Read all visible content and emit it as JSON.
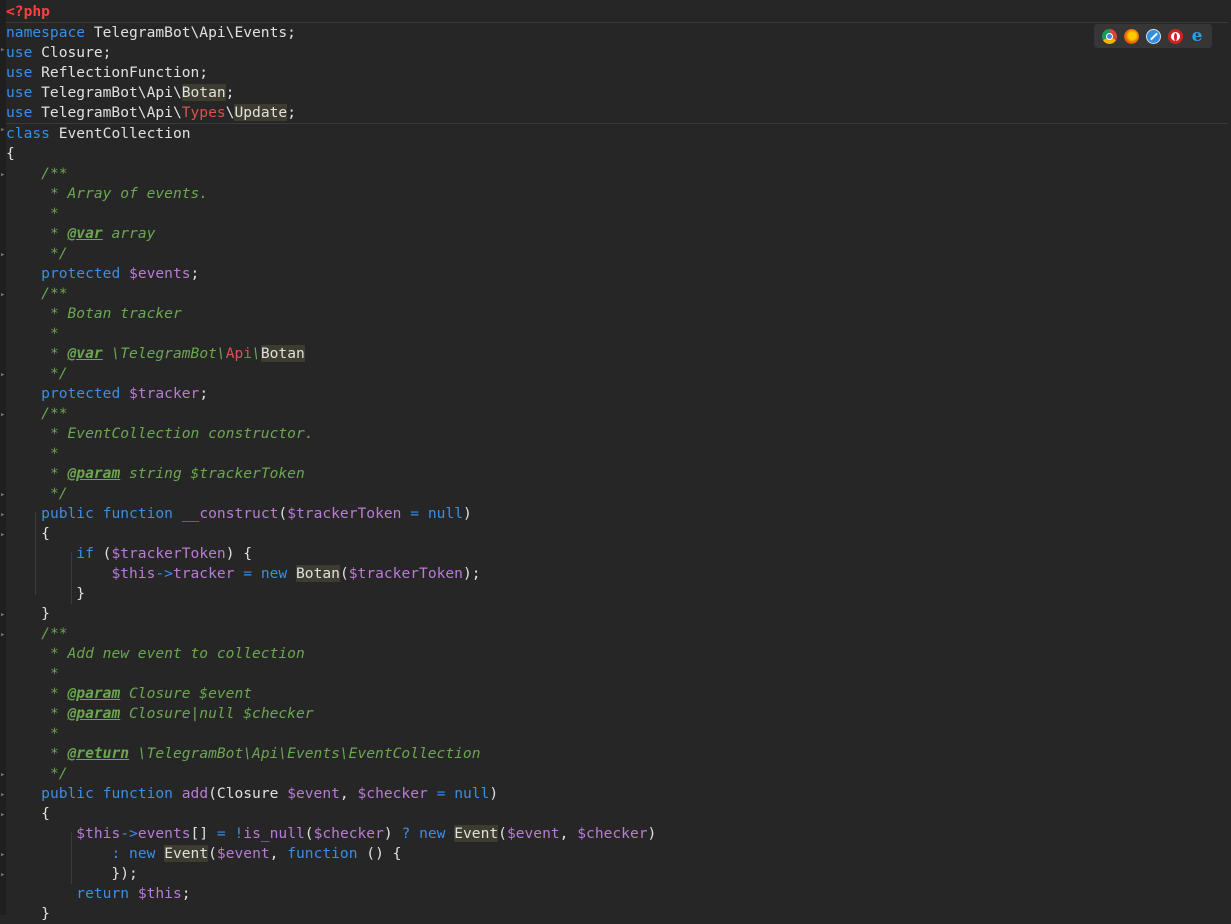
{
  "editor": {
    "language": "php",
    "lines": [
      [
        {
          "t": "<?php",
          "c": "tag"
        }
      ],
      [
        {
          "t": "namespace",
          "c": "kw"
        },
        {
          "t": " TelegramBot\\Api\\Events;"
        }
      ],
      [
        {
          "t": "use",
          "c": "kw"
        },
        {
          "t": " Closure;"
        }
      ],
      [
        {
          "t": "use",
          "c": "kw"
        },
        {
          "t": " ReflectionFunction;"
        }
      ],
      [
        {
          "t": "use",
          "c": "kw"
        },
        {
          "t": " TelegramBot\\Api\\"
        },
        {
          "t": "Botan",
          "c": "hl"
        },
        {
          "t": ";"
        }
      ],
      [
        {
          "t": "use",
          "c": "kw"
        },
        {
          "t": " TelegramBot\\Api\\"
        },
        {
          "t": "Types",
          "c": "red"
        },
        {
          "t": "\\"
        },
        {
          "t": "Update",
          "c": "hl"
        },
        {
          "t": ";"
        }
      ],
      [
        {
          "t": "class",
          "c": "kw"
        },
        {
          "t": " EventCollection"
        }
      ],
      [
        {
          "t": "{"
        }
      ],
      [
        {
          "t": "    "
        },
        {
          "t": "/**",
          "c": "cm"
        }
      ],
      [
        {
          "t": "     "
        },
        {
          "t": "* Array of events.",
          "c": "cm"
        }
      ],
      [
        {
          "t": "     "
        },
        {
          "t": "*",
          "c": "cm"
        }
      ],
      [
        {
          "t": "     "
        },
        {
          "t": "* ",
          "c": "cm"
        },
        {
          "t": "@var",
          "c": "doctag"
        },
        {
          "t": " array",
          "c": "cm"
        }
      ],
      [
        {
          "t": "     "
        },
        {
          "t": "*/",
          "c": "cm"
        }
      ],
      [
        {
          "t": "    "
        },
        {
          "t": "protected",
          "c": "kw"
        },
        {
          "t": " "
        },
        {
          "t": "$events",
          "c": "var"
        },
        {
          "t": ";"
        }
      ],
      [
        {
          "t": "    "
        },
        {
          "t": "/**",
          "c": "cm"
        }
      ],
      [
        {
          "t": "     "
        },
        {
          "t": "* Botan tracker",
          "c": "cm"
        }
      ],
      [
        {
          "t": "     "
        },
        {
          "t": "*",
          "c": "cm"
        }
      ],
      [
        {
          "t": "     "
        },
        {
          "t": "* ",
          "c": "cm"
        },
        {
          "t": "@var",
          "c": "doctag"
        },
        {
          "t": " \\TelegramBot\\",
          "c": "cm"
        },
        {
          "t": "Api",
          "c": "red"
        },
        {
          "t": "\\",
          "c": "cm"
        },
        {
          "t": "Botan",
          "c": "hl"
        }
      ],
      [
        {
          "t": "     "
        },
        {
          "t": "*/",
          "c": "cm"
        }
      ],
      [
        {
          "t": "    "
        },
        {
          "t": "protected",
          "c": "kw"
        },
        {
          "t": " "
        },
        {
          "t": "$tracker",
          "c": "var"
        },
        {
          "t": ";"
        }
      ],
      [
        {
          "t": "    "
        },
        {
          "t": "/**",
          "c": "cm"
        }
      ],
      [
        {
          "t": "     "
        },
        {
          "t": "* EventCollection constructor.",
          "c": "cm"
        }
      ],
      [
        {
          "t": "     "
        },
        {
          "t": "*",
          "c": "cm"
        }
      ],
      [
        {
          "t": "     "
        },
        {
          "t": "* ",
          "c": "cm"
        },
        {
          "t": "@param",
          "c": "doctag"
        },
        {
          "t": " string $trackerToken",
          "c": "cm"
        }
      ],
      [
        {
          "t": "     "
        },
        {
          "t": "*/",
          "c": "cm"
        }
      ],
      [
        {
          "t": "    "
        },
        {
          "t": "public",
          "c": "kw"
        },
        {
          "t": " "
        },
        {
          "t": "function",
          "c": "kw"
        },
        {
          "t": " "
        },
        {
          "t": "__construct",
          "c": "fn"
        },
        {
          "t": "("
        },
        {
          "t": "$trackerToken",
          "c": "var"
        },
        {
          "t": " "
        },
        {
          "t": "=",
          "c": "kw"
        },
        {
          "t": " "
        },
        {
          "t": "null",
          "c": "kw"
        },
        {
          "t": ")"
        }
      ],
      [
        {
          "t": "    {"
        }
      ],
      [
        {
          "t": "        "
        },
        {
          "t": "if",
          "c": "kw"
        },
        {
          "t": " ("
        },
        {
          "t": "$trackerToken",
          "c": "var"
        },
        {
          "t": ") {"
        }
      ],
      [
        {
          "t": "            "
        },
        {
          "t": "$this",
          "c": "var"
        },
        {
          "t": "->",
          "c": "kw"
        },
        {
          "t": "tracker",
          "c": "var"
        },
        {
          "t": " "
        },
        {
          "t": "=",
          "c": "kw"
        },
        {
          "t": " "
        },
        {
          "t": "new",
          "c": "kw"
        },
        {
          "t": " "
        },
        {
          "t": "Botan",
          "c": "hl"
        },
        {
          "t": "("
        },
        {
          "t": "$trackerToken",
          "c": "var"
        },
        {
          "t": ");"
        }
      ],
      [
        {
          "t": "        }"
        }
      ],
      [
        {
          "t": "    }"
        }
      ],
      [
        {
          "t": "    "
        },
        {
          "t": "/**",
          "c": "cm"
        }
      ],
      [
        {
          "t": "     "
        },
        {
          "t": "* Add new event to collection",
          "c": "cm"
        }
      ],
      [
        {
          "t": "     "
        },
        {
          "t": "*",
          "c": "cm"
        }
      ],
      [
        {
          "t": "     "
        },
        {
          "t": "* ",
          "c": "cm"
        },
        {
          "t": "@param",
          "c": "doctag"
        },
        {
          "t": " Closure $event",
          "c": "cm"
        }
      ],
      [
        {
          "t": "     "
        },
        {
          "t": "* ",
          "c": "cm"
        },
        {
          "t": "@param",
          "c": "doctag"
        },
        {
          "t": " Closure|null $checker",
          "c": "cm"
        }
      ],
      [
        {
          "t": "     "
        },
        {
          "t": "*",
          "c": "cm"
        }
      ],
      [
        {
          "t": "     "
        },
        {
          "t": "* ",
          "c": "cm"
        },
        {
          "t": "@return",
          "c": "doctag"
        },
        {
          "t": " \\TelegramBot\\Api\\Events\\EventCollection",
          "c": "cm"
        }
      ],
      [
        {
          "t": "     "
        },
        {
          "t": "*/",
          "c": "cm"
        }
      ],
      [
        {
          "t": "    "
        },
        {
          "t": "public",
          "c": "kw"
        },
        {
          "t": " "
        },
        {
          "t": "function",
          "c": "kw"
        },
        {
          "t": " "
        },
        {
          "t": "add",
          "c": "fn"
        },
        {
          "t": "(Closure "
        },
        {
          "t": "$event",
          "c": "var"
        },
        {
          "t": ", "
        },
        {
          "t": "$checker",
          "c": "var"
        },
        {
          "t": " "
        },
        {
          "t": "=",
          "c": "kw"
        },
        {
          "t": " "
        },
        {
          "t": "null",
          "c": "kw"
        },
        {
          "t": ")"
        }
      ],
      [
        {
          "t": "    {"
        }
      ],
      [
        {
          "t": "        "
        },
        {
          "t": "$this",
          "c": "var"
        },
        {
          "t": "->",
          "c": "kw"
        },
        {
          "t": "events",
          "c": "var"
        },
        {
          "t": "[] "
        },
        {
          "t": "=",
          "c": "kw"
        },
        {
          "t": " "
        },
        {
          "t": "!",
          "c": "kw"
        },
        {
          "t": "is_null",
          "c": "fn"
        },
        {
          "t": "("
        },
        {
          "t": "$checker",
          "c": "var"
        },
        {
          "t": ") "
        },
        {
          "t": "?",
          "c": "kw"
        },
        {
          "t": " "
        },
        {
          "t": "new",
          "c": "kw"
        },
        {
          "t": " "
        },
        {
          "t": "Event",
          "c": "hl"
        },
        {
          "t": "("
        },
        {
          "t": "$event",
          "c": "var"
        },
        {
          "t": ", "
        },
        {
          "t": "$checker",
          "c": "var"
        },
        {
          "t": ")"
        }
      ],
      [
        {
          "t": "            "
        },
        {
          "t": ":",
          "c": "kw"
        },
        {
          "t": " "
        },
        {
          "t": "new",
          "c": "kw"
        },
        {
          "t": " "
        },
        {
          "t": "Event",
          "c": "hl"
        },
        {
          "t": "("
        },
        {
          "t": "$event",
          "c": "var"
        },
        {
          "t": ", "
        },
        {
          "t": "function",
          "c": "kw"
        },
        {
          "t": " () {"
        }
      ],
      [
        {
          "t": "            });"
        }
      ],
      [
        {
          "t": "        "
        },
        {
          "t": "return",
          "c": "kw"
        },
        {
          "t": " "
        },
        {
          "t": "$this",
          "c": "var"
        },
        {
          "t": ";"
        }
      ],
      [
        {
          "t": "    }"
        }
      ]
    ]
  },
  "browser_icons": [
    "chrome-icon",
    "firefox-icon",
    "safari-icon",
    "opera-icon",
    "ie-icon"
  ],
  "ie_glyph": "e"
}
